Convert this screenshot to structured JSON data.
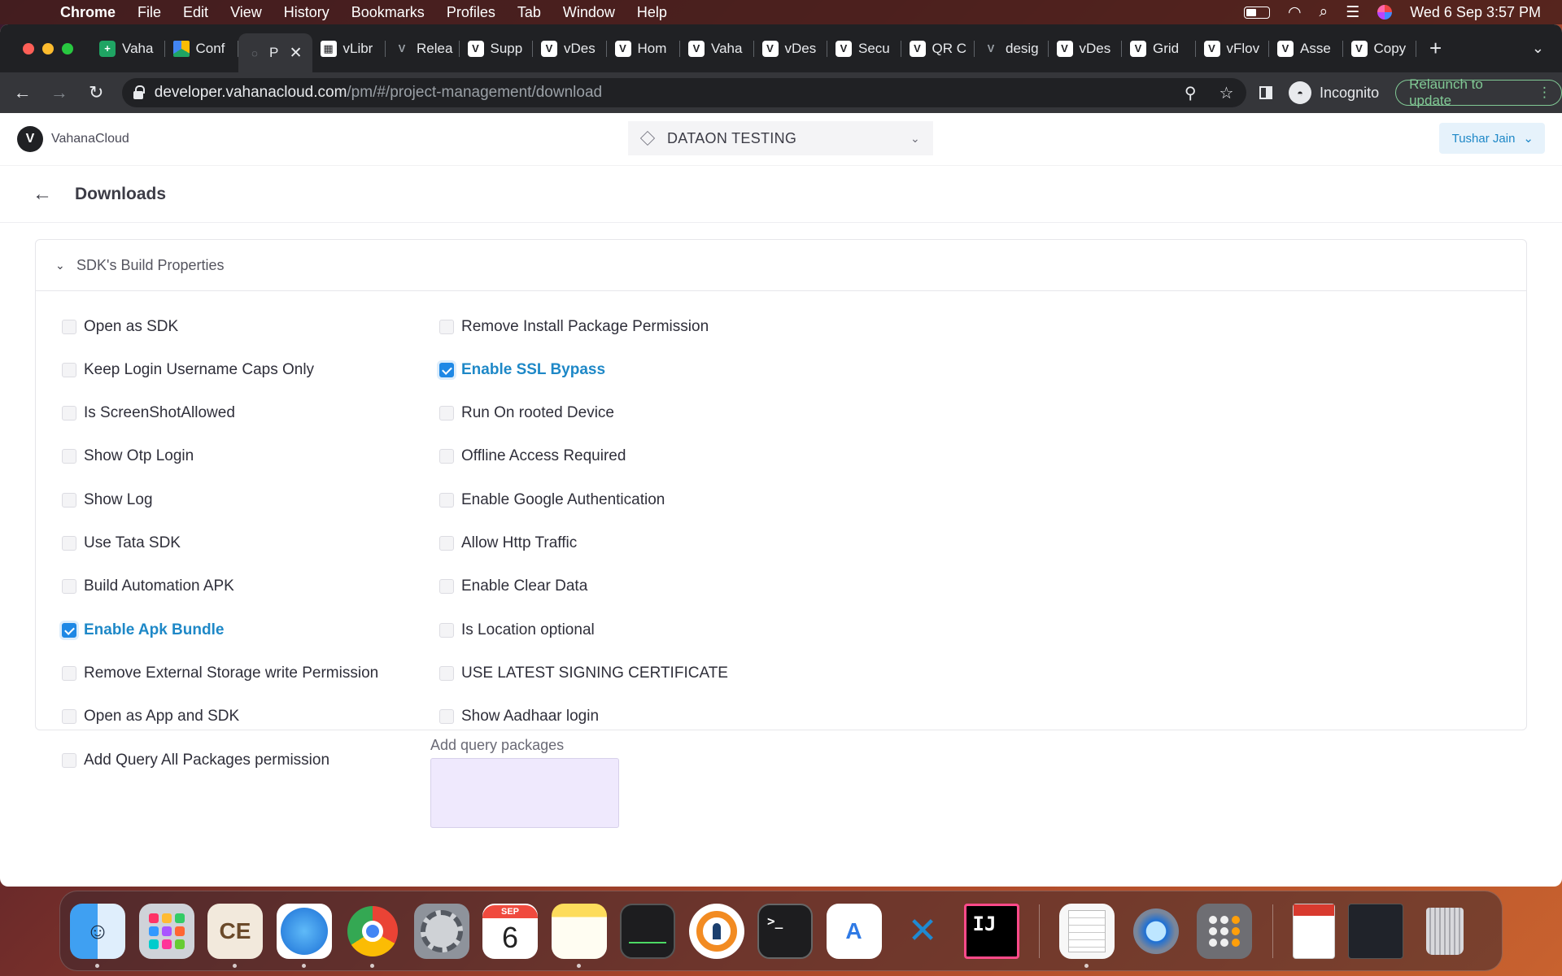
{
  "menubar": {
    "app_name": "Chrome",
    "items": [
      "File",
      "Edit",
      "View",
      "History",
      "Bookmarks",
      "Profiles",
      "Tab",
      "Window",
      "Help"
    ],
    "datetime": "Wed 6 Sep  3:57 PM"
  },
  "browser": {
    "tabs": [
      {
        "label": "Vaha",
        "icon": "sheets-icon"
      },
      {
        "label": "Conf",
        "icon": "drive-icon"
      },
      {
        "label": "P",
        "icon": "loading-icon",
        "active": true
      },
      {
        "label": "vLibr",
        "icon": "store-icon"
      },
      {
        "label": "Relea",
        "icon": "v-logo-icon"
      },
      {
        "label": "Supp",
        "icon": "v-icon"
      },
      {
        "label": "vDes",
        "icon": "v-icon"
      },
      {
        "label": "Hom",
        "icon": "v-icon"
      },
      {
        "label": "Vaha",
        "icon": "v-icon"
      },
      {
        "label": "vDes",
        "icon": "v-icon"
      },
      {
        "label": "Secu",
        "icon": "v-icon"
      },
      {
        "label": "QR C",
        "icon": "v-icon"
      },
      {
        "label": "desig",
        "icon": "v-logo-icon"
      },
      {
        "label": "vDes",
        "icon": "v-icon"
      },
      {
        "label": "Grid",
        "icon": "v-icon"
      },
      {
        "label": "vFlov",
        "icon": "v-icon"
      },
      {
        "label": "Asse",
        "icon": "v-icon"
      },
      {
        "label": "Copy",
        "icon": "v-icon"
      }
    ],
    "url_host": "developer.vahanacloud.com",
    "url_path": "/pm/#/project-management/download",
    "incognito_label": "Incognito",
    "relaunch_label": "Relaunch to update"
  },
  "app": {
    "brand": "VahanaCloud",
    "project_name": "DATAON TESTING",
    "user_name": "Tushar Jain",
    "page_title": "Downloads",
    "section_title": "SDK's Build Properties",
    "left_options": [
      {
        "label": "Open as SDK",
        "checked": false
      },
      {
        "label": "Keep Login Username Caps Only",
        "checked": false
      },
      {
        "label": "Is ScreenShotAllowed",
        "checked": false
      },
      {
        "label": "Show Otp Login",
        "checked": false
      },
      {
        "label": "Show Log",
        "checked": false
      },
      {
        "label": "Use Tata SDK",
        "checked": false
      },
      {
        "label": "Build Automation APK",
        "checked": false
      },
      {
        "label": "Enable Apk Bundle",
        "checked": true
      },
      {
        "label": "Remove External Storage write Permission",
        "checked": false
      },
      {
        "label": "Open as App and SDK",
        "checked": false
      },
      {
        "label": "Add Query All Packages permission",
        "checked": false
      }
    ],
    "right_options": [
      {
        "label": "Remove Install Package Permission",
        "checked": false
      },
      {
        "label": "Enable SSL Bypass",
        "checked": true
      },
      {
        "label": "Run On rooted Device",
        "checked": false
      },
      {
        "label": "Offline Access Required",
        "checked": false
      },
      {
        "label": "Enable Google Authentication",
        "checked": false
      },
      {
        "label": "Allow Http Traffic",
        "checked": false
      },
      {
        "label": "Enable Clear Data",
        "checked": false
      },
      {
        "label": "Is Location optional",
        "checked": false
      },
      {
        "label": "USE LATEST SIGNING CERTIFICATE",
        "checked": false
      },
      {
        "label": "Show Aadhaar login",
        "checked": false
      }
    ],
    "query_packages_label": "Add query packages",
    "query_packages_value": ""
  },
  "dock": {
    "calendar_month": "SEP",
    "calendar_day": "6",
    "apps": [
      "finder",
      "launchpad",
      "dbeaver",
      "safari",
      "chrome",
      "system-settings",
      "calendar",
      "notes",
      "activity-monitor",
      "openvpn",
      "terminal",
      "android-studio",
      "vscode",
      "intellij",
      "textedit",
      "quicktime",
      "calculator",
      "document",
      "terminal-window",
      "trash"
    ]
  },
  "colors": {
    "accent": "#1e88e5",
    "checked_label": "#1e88c7",
    "relaunch": "#81c995",
    "query_box": "#efe9fd"
  }
}
